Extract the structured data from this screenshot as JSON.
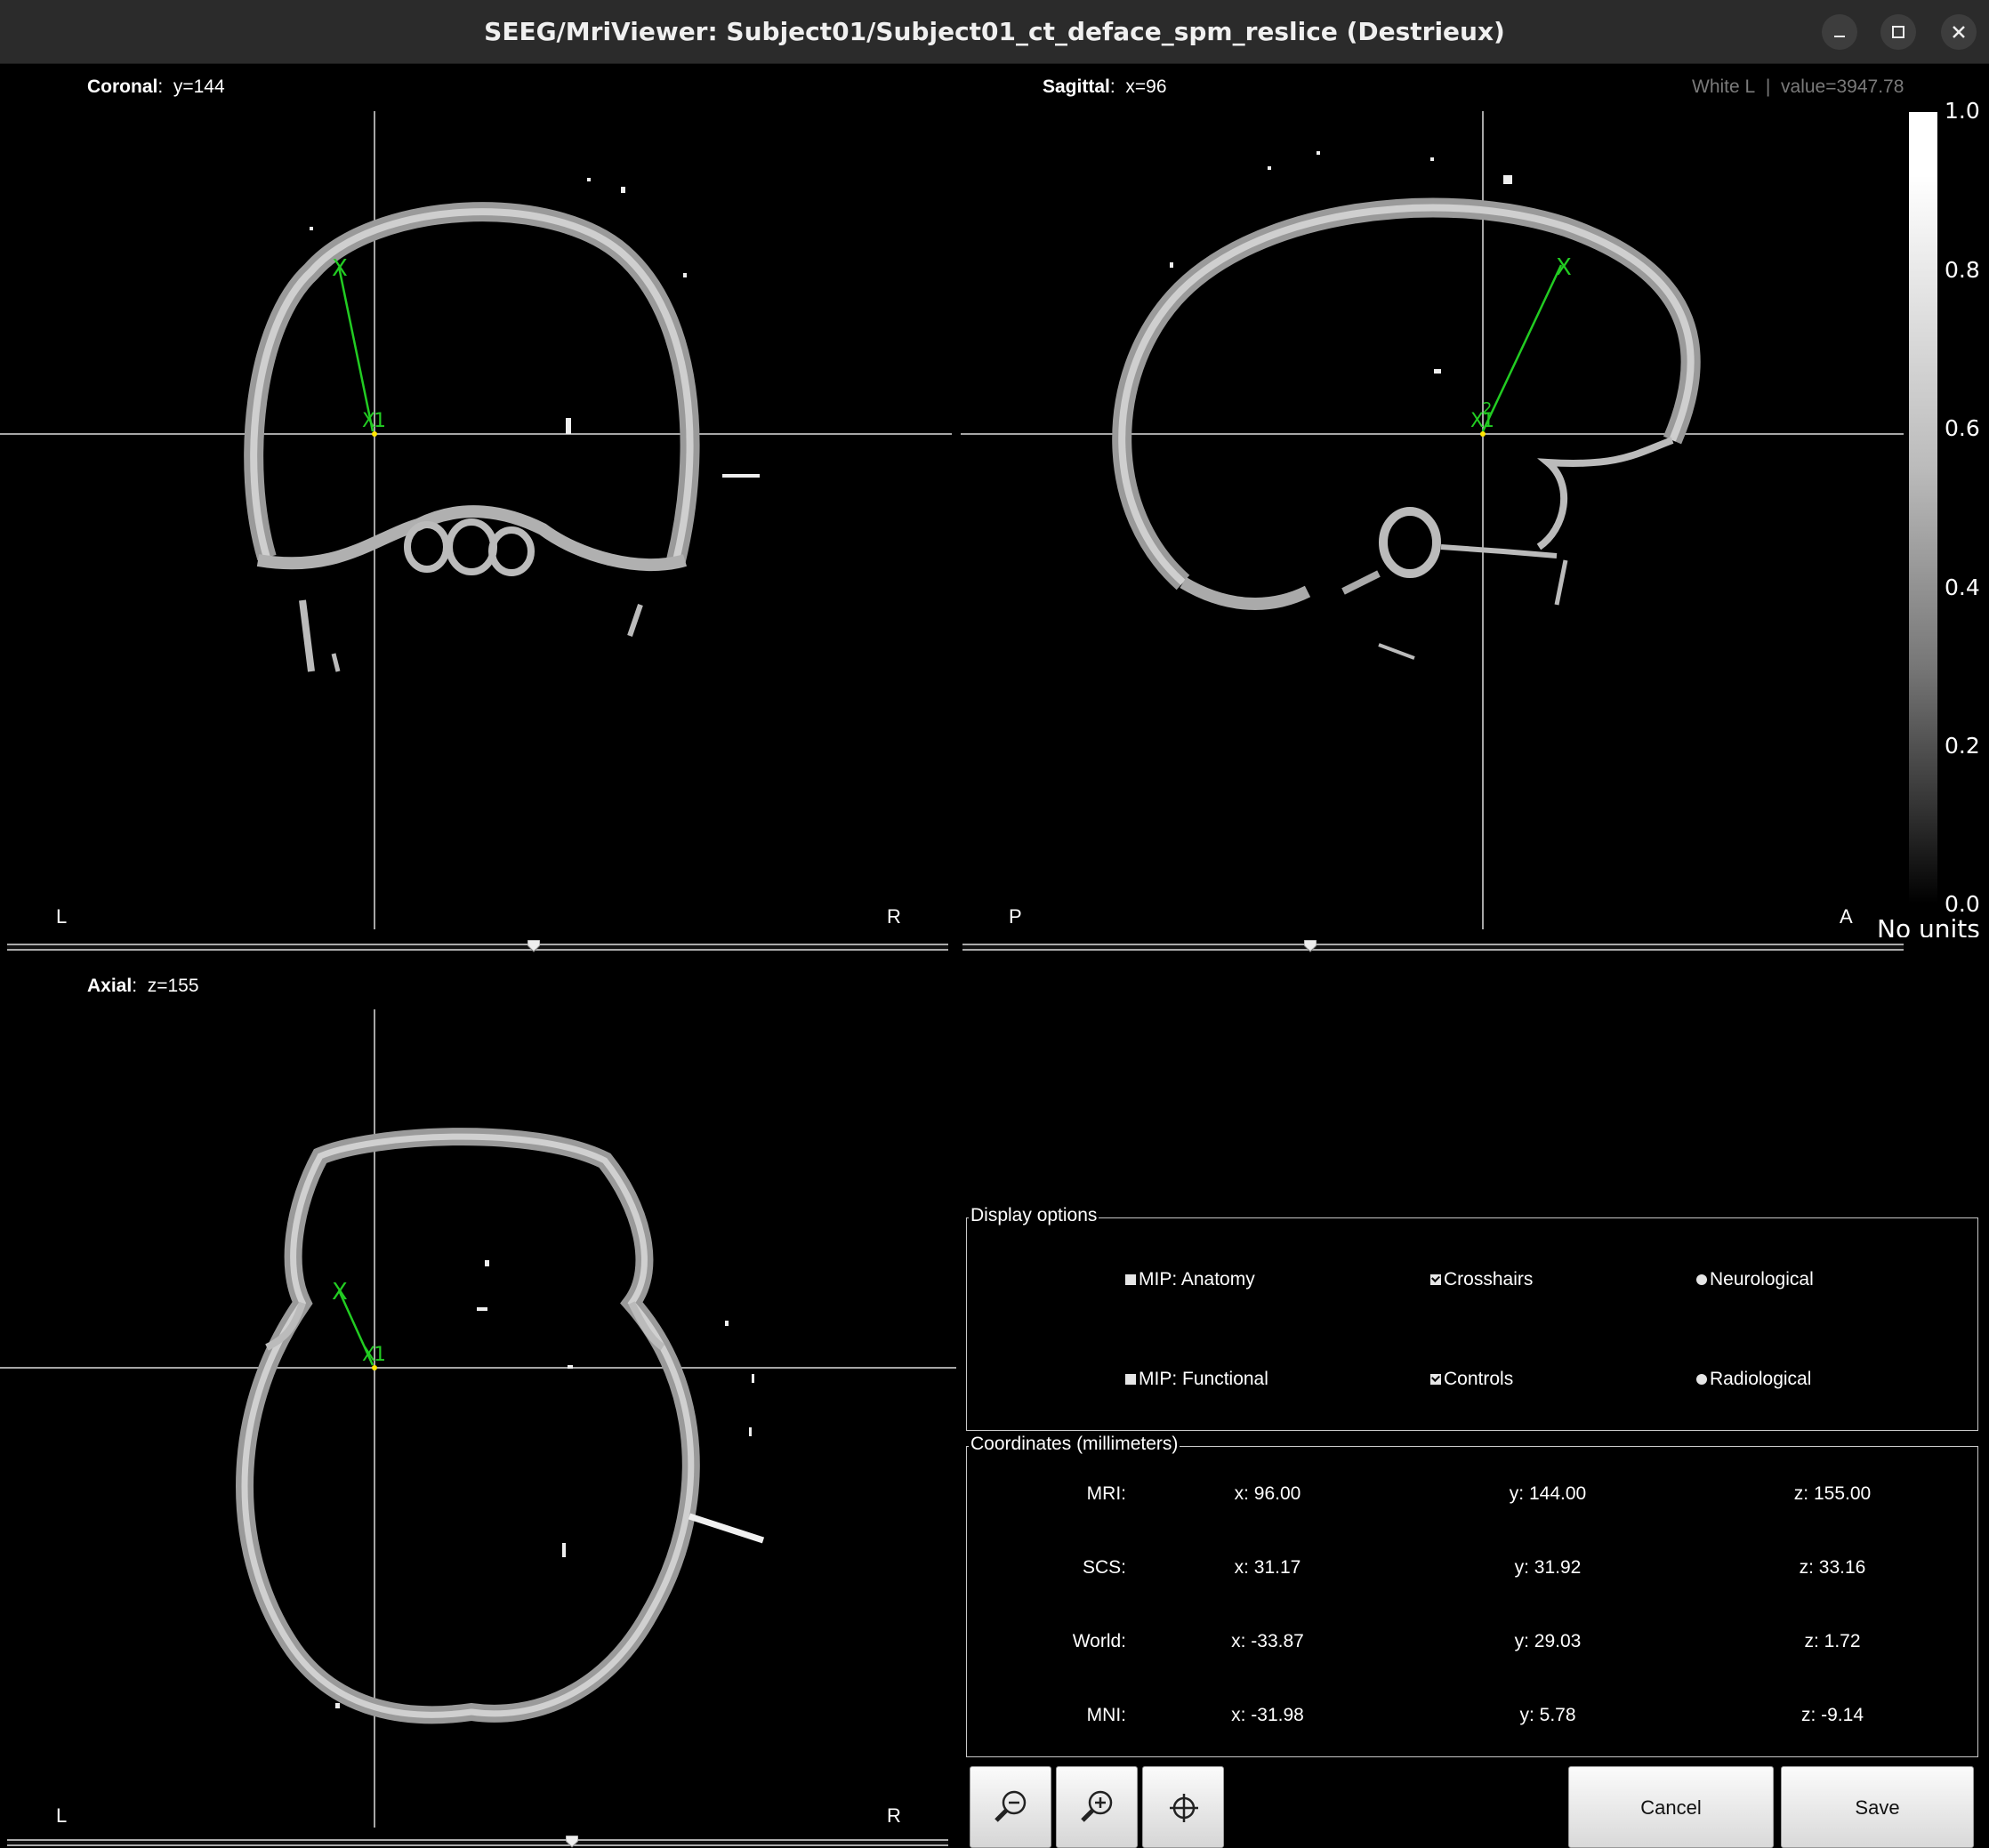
{
  "window": {
    "title": "SEEG/MriViewer: Subject01/Subject01_ct_deface_spm_reslice (Destrieux)",
    "buttons": [
      "minimize-icon",
      "maximize-icon",
      "close-icon"
    ]
  },
  "views": {
    "coronal": {
      "name": "Coronal",
      "value": "y=144",
      "left": "L",
      "right": "R"
    },
    "sagittal": {
      "name": "Sagittal",
      "value": "x=96",
      "left": "P",
      "right": "A"
    },
    "axial": {
      "name": "Axial",
      "value": "z=155",
      "left": "L",
      "right": "R"
    }
  },
  "status": {
    "region": "White L",
    "separator": "|",
    "value": "value=3947.78"
  },
  "colorbar": {
    "ticks": [
      "1.0",
      "0.8",
      "0.6",
      "0.4",
      "0.2",
      "0.0"
    ],
    "units": "No units"
  },
  "markers": {
    "point1": "1",
    "point2": "2",
    "x": "X"
  },
  "sliders": {
    "coronal": 0.56,
    "sagittal": 0.37,
    "axial": 0.6
  },
  "display_options": {
    "title": "Display options",
    "mip_anatomy": {
      "label": "MIP: Anatomy",
      "checked": false
    },
    "mip_functional": {
      "label": "MIP: Functional",
      "checked": false
    },
    "crosshairs": {
      "label": "Crosshairs",
      "checked": true
    },
    "controls": {
      "label": "Controls",
      "checked": true
    },
    "neurological": {
      "label": "Neurological",
      "selected": true
    },
    "radiological": {
      "label": "Radiological",
      "selected": false
    }
  },
  "coordinates": {
    "title": "Coordinates (millimeters)",
    "rows": [
      {
        "label": "MRI:",
        "x": "x: 96.00",
        "y": "y: 144.00",
        "z": "z: 155.00"
      },
      {
        "label": "SCS:",
        "x": "x: 31.17",
        "y": "y: 31.92",
        "z": "z: 33.16"
      },
      {
        "label": "World:",
        "x": "x: -33.87",
        "y": "y: 29.03",
        "z": "z: 1.72"
      },
      {
        "label": "MNI:",
        "x": "x: -31.98",
        "y": "y: 5.78",
        "z": "z: -9.14"
      }
    ]
  },
  "toolbar": {
    "zoom_out": "zoom-out-icon",
    "zoom_in": "zoom-in-icon",
    "center": "crosshair-target-icon",
    "cancel_label": "Cancel",
    "save_label": "Save"
  },
  "colors": {
    "marker_green": "#22cc22",
    "crosshair": "#ffffff",
    "background": "#000000"
  }
}
